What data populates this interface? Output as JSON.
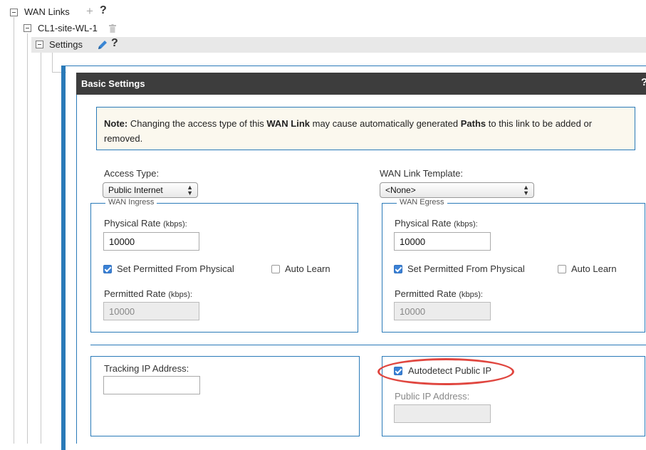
{
  "tree": {
    "root_label": "WAN Links",
    "root_add": "+",
    "root_help": "?",
    "child_label": "CL1-site-WL-1",
    "settings_label": "Settings",
    "settings_help": "?"
  },
  "panel": {
    "title": "Basic Settings",
    "help": "?",
    "note": {
      "prefix": "Note:",
      "t1": " Changing the access type of this ",
      "b1": "WAN Link",
      "t2": " may cause automatically generated ",
      "b2": "Paths",
      "t3": " to this link to be added or",
      "line2": "removed."
    },
    "access_type": {
      "label": "Access Type:",
      "value": "Public Internet"
    },
    "template": {
      "label": "WAN Link Template:",
      "value": "<None>"
    },
    "ingress": {
      "legend": "WAN Ingress",
      "physical_label": "Physical Rate",
      "physical_unit": "(kbps):",
      "physical_value": "10000",
      "set_permitted_label": "Set Permitted From Physical",
      "set_permitted_checked": true,
      "auto_learn_label": "Auto Learn",
      "auto_learn_checked": false,
      "permitted_label": "Permitted Rate",
      "permitted_unit": "(kbps):",
      "permitted_value": "10000"
    },
    "egress": {
      "legend": "WAN Egress",
      "physical_label": "Physical Rate",
      "physical_unit": "(kbps):",
      "physical_value": "10000",
      "set_permitted_label": "Set Permitted From Physical",
      "set_permitted_checked": true,
      "auto_learn_label": "Auto Learn",
      "auto_learn_checked": false,
      "permitted_label": "Permitted Rate",
      "permitted_unit": "(kbps):",
      "permitted_value": "10000"
    },
    "tracking_ip": {
      "label": "Tracking IP Address:",
      "value": ""
    },
    "autodetect": {
      "label": "Autodetect Public IP",
      "checked": true
    },
    "public_ip": {
      "label": "Public IP Address:",
      "value": ""
    }
  },
  "colors": {
    "accent_blue": "#2a7ab8",
    "header_bg": "#3d3d3d",
    "note_bg": "#fbf8ee",
    "highlight_red": "#e0463f"
  }
}
